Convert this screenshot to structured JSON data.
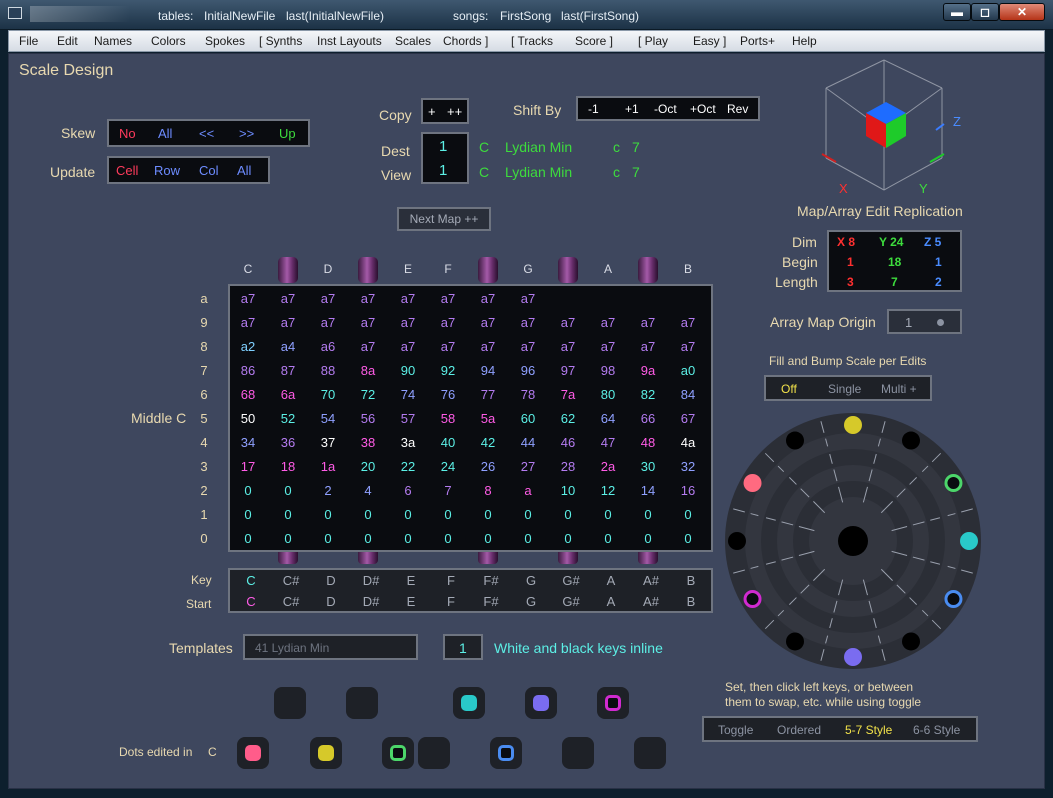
{
  "titlebar": {
    "tables_label": "tables:",
    "tables_value": "InitialNewFile",
    "tables_last": "last(InitialNewFile)",
    "songs_label": "songs:",
    "songs_value": "FirstSong",
    "songs_last": "last(FirstSong)",
    "min": "▬",
    "max": "◻",
    "close": "✕"
  },
  "menu": [
    "File",
    "Edit",
    "Names",
    "Colors",
    "Spokes",
    "[ Synths",
    "Inst Layouts",
    "Scales",
    "Chords ]",
    "[ Tracks",
    "Score ]",
    "[ Play",
    "Easy ]",
    "Ports+",
    "Help"
  ],
  "page_title": "Scale Design",
  "skew": {
    "label": "Skew",
    "options": [
      {
        "text": "No",
        "color": "#ff3b5c"
      },
      {
        "text": "All",
        "color": "#6d8cff"
      },
      {
        "text": "<<",
        "color": "#6d8cff"
      },
      {
        "text": ">>",
        "color": "#6d8cff"
      },
      {
        "text": "Up",
        "color": "#3ddc3d"
      }
    ]
  },
  "update": {
    "label": "Update",
    "options": [
      {
        "text": "Cell",
        "color": "#ff3b5c"
      },
      {
        "text": "Row",
        "color": "#6d8cff"
      },
      {
        "text": "Col",
        "color": "#6d8cff"
      },
      {
        "text": "All",
        "color": "#6d8cff"
      }
    ]
  },
  "copy": {
    "label": "Copy",
    "plus": "+",
    "plusplus": "++"
  },
  "shift": {
    "label": "Shift By",
    "opts": [
      "-1",
      "+1",
      "-Oct",
      "+Oct",
      "Rev"
    ]
  },
  "dest": {
    "label": "Dest",
    "value": "1",
    "key": "C",
    "scale": "Lydian Min",
    "note": "c",
    "num": "7"
  },
  "view": {
    "label": "View",
    "value": "1",
    "key": "C",
    "scale": "Lydian Min",
    "note": "c",
    "num": "7"
  },
  "next_map": "Next Map ++",
  "cube": {
    "x": "X",
    "y": "Y",
    "z": "Z"
  },
  "replication": {
    "title": "Map/Array Edit Replication",
    "rows": [
      {
        "label": "Dim",
        "x": "X  8",
        "y": "Y 24",
        "z": "Z  5"
      },
      {
        "label": "Begin",
        "x": "1",
        "y": "18",
        "z": "1"
      },
      {
        "label": "Length",
        "x": "3",
        "y": "7",
        "z": "2"
      }
    ]
  },
  "origin": {
    "label": "Array Map Origin",
    "value": "1"
  },
  "fill": {
    "label": "Fill and Bump Scale per Edits",
    "opts": [
      {
        "text": "Off",
        "color": "#f2e24a"
      },
      {
        "text": "Single",
        "color": "#8c93a2"
      },
      {
        "text": "Multi +",
        "color": "#8c93a2"
      }
    ]
  },
  "col_headers": [
    "C",
    "",
    "D",
    "",
    "E",
    "F",
    "",
    "G",
    "",
    "A",
    "",
    "B"
  ],
  "row_labels": [
    "a",
    "9",
    "8",
    "7",
    "6",
    "5",
    "4",
    "3",
    "2",
    "1",
    "0"
  ],
  "middle_c": "Middle C",
  "grid": [
    [
      "a7",
      "a7",
      "a7",
      "a7",
      "a7",
      "a7",
      "a7",
      "a7",
      "",
      "",
      "",
      ""
    ],
    [
      "a7",
      "a7",
      "a7",
      "a7",
      "a7",
      "a7",
      "a7",
      "a7",
      "a7",
      "a7",
      "a7",
      "a7"
    ],
    [
      "a2",
      "a4",
      "a6",
      "a7",
      "a7",
      "a7",
      "a7",
      "a7",
      "a7",
      "a7",
      "a7",
      "a7"
    ],
    [
      "86",
      "87",
      "88",
      "8a",
      "90",
      "92",
      "94",
      "96",
      "97",
      "98",
      "9a",
      "a0"
    ],
    [
      "68",
      "6a",
      "70",
      "72",
      "74",
      "76",
      "77",
      "78",
      "7a",
      "80",
      "82",
      "84"
    ],
    [
      "50",
      "52",
      "54",
      "56",
      "57",
      "58",
      "5a",
      "60",
      "62",
      "64",
      "66",
      "67"
    ],
    [
      "34",
      "36",
      "37",
      "38",
      "3a",
      "40",
      "42",
      "44",
      "46",
      "47",
      "48",
      "4a"
    ],
    [
      "17",
      "18",
      "1a",
      "20",
      "22",
      "24",
      "26",
      "27",
      "28",
      "2a",
      "30",
      "32"
    ],
    [
      "0",
      "0",
      "2",
      "4",
      "6",
      "7",
      "8",
      "a",
      "10",
      "12",
      "14",
      "16"
    ],
    [
      "0",
      "0",
      "0",
      "0",
      "0",
      "0",
      "0",
      "0",
      "0",
      "0",
      "0",
      "0"
    ],
    [
      "0",
      "0",
      "0",
      "0",
      "0",
      "0",
      "0",
      "0",
      "0",
      "0",
      "0",
      "0"
    ]
  ],
  "grid_colors": [
    [
      "#b47cf0",
      "#b47cf0",
      "#b47cf0",
      "#b47cf0",
      "#b47cf0",
      "#b47cf0",
      "#b47cf0",
      "#b47cf0",
      "#b47cf0",
      "#b47cf0",
      "#b47cf0",
      "#b47cf0"
    ],
    [
      "#b47cf0",
      "#b47cf0",
      "#b47cf0",
      "#b47cf0",
      "#b47cf0",
      "#b47cf0",
      "#b47cf0",
      "#b47cf0",
      "#b47cf0",
      "#b47cf0",
      "#b47cf0",
      "#b47cf0"
    ],
    [
      "#7fd0ff",
      "#8fa0ff",
      "#b47cf0",
      "#b47cf0",
      "#b47cf0",
      "#b47cf0",
      "#b47cf0",
      "#b47cf0",
      "#b47cf0",
      "#b47cf0",
      "#b47cf0",
      "#b47cf0"
    ],
    [
      "#b47cf0",
      "#b47cf0",
      "#b47cf0",
      "#ff5ce6",
      "#5cf0e6",
      "#5cf0e6",
      "#8fa0ff",
      "#8fa0ff",
      "#b47cf0",
      "#b47cf0",
      "#ff5ce6",
      "#5cf0e6"
    ],
    [
      "#ff5ce6",
      "#ff5ce6",
      "#5cf0e6",
      "#5cf0e6",
      "#8fa0ff",
      "#8fa0ff",
      "#b47cf0",
      "#b47cf0",
      "#ff5ce6",
      "#5cf0e6",
      "#5cf0e6",
      "#8fa0ff"
    ],
    [
      "#ffffff",
      "#5cf0e6",
      "#8fa0ff",
      "#b47cf0",
      "#b47cf0",
      "#ff5ce6",
      "#ff5ce6",
      "#5cf0e6",
      "#5cf0e6",
      "#8fa0ff",
      "#b47cf0",
      "#b47cf0"
    ],
    [
      "#8fa0ff",
      "#b47cf0",
      "#ffffff",
      "#ff5ce6",
      "#ffffff",
      "#5cf0e6",
      "#5cf0e6",
      "#8fa0ff",
      "#b47cf0",
      "#b47cf0",
      "#ff5ce6",
      "#ffffff"
    ],
    [
      "#ff5ce6",
      "#ff5ce6",
      "#ff5ce6",
      "#5cf0e6",
      "#5cf0e6",
      "#5cf0e6",
      "#8fa0ff",
      "#b47cf0",
      "#b47cf0",
      "#ff5ce6",
      "#5cf0e6",
      "#8fa0ff"
    ],
    [
      "#5cf0e6",
      "#5cf0e6",
      "#8fa0ff",
      "#8fa0ff",
      "#b47cf0",
      "#b47cf0",
      "#ff5ce6",
      "#ff5ce6",
      "#5cf0e6",
      "#5cf0e6",
      "#8fa0ff",
      "#b47cf0"
    ],
    [
      "#5cf0e6",
      "#5cf0e6",
      "#5cf0e6",
      "#5cf0e6",
      "#5cf0e6",
      "#5cf0e6",
      "#5cf0e6",
      "#5cf0e6",
      "#5cf0e6",
      "#5cf0e6",
      "#5cf0e6",
      "#5cf0e6"
    ],
    [
      "#5cf0e6",
      "#5cf0e6",
      "#5cf0e6",
      "#5cf0e6",
      "#5cf0e6",
      "#5cf0e6",
      "#5cf0e6",
      "#5cf0e6",
      "#5cf0e6",
      "#5cf0e6",
      "#5cf0e6",
      "#5cf0e6"
    ]
  ],
  "keys": {
    "key_label": "Key",
    "start_label": "Start",
    "key_row": [
      "C",
      "C#",
      "D",
      "D#",
      "E",
      "F",
      "F#",
      "G",
      "G#",
      "A",
      "A#",
      "B"
    ],
    "start_row": [
      "C",
      "C#",
      "D",
      "D#",
      "E",
      "F",
      "F#",
      "G",
      "G#",
      "A",
      "A#",
      "B"
    ]
  },
  "templates": {
    "label": "Templates",
    "value": "41   Lydian Min",
    "inline_value": "1",
    "inline_label": "White and black keys inline"
  },
  "dots_label": "Dots edited in",
  "dots_key": "C",
  "pads_top": [
    {
      "color": "",
      "ring": false
    },
    {
      "color": "",
      "ring": false
    },
    {
      "color": "#29c9c9",
      "ring": false
    },
    {
      "color": "#7a6cf0",
      "ring": false
    },
    {
      "color": "#d02ad0",
      "ring": true
    }
  ],
  "pads_bottom": [
    {
      "color": "#ff5c8a",
      "ring": false
    },
    {
      "color": "#d6c92a",
      "ring": false
    },
    {
      "color": "#4cd66a",
      "ring": true
    },
    {
      "color": "",
      "ring": false
    },
    {
      "color": "#4a8cf0",
      "ring": true
    },
    {
      "color": "",
      "ring": false
    },
    {
      "color": "",
      "ring": false
    }
  ],
  "wheel_dots": [
    {
      "a": 0,
      "color": "#d6c92a",
      "fill": true
    },
    {
      "a": 30,
      "color": "#000000",
      "fill": true
    },
    {
      "a": 60,
      "color": "#4cd66a",
      "fill": false
    },
    {
      "a": 90,
      "color": "#29c9c9",
      "fill": true
    },
    {
      "a": 120,
      "color": "#4a8cf0",
      "fill": false
    },
    {
      "a": 150,
      "color": "#000000",
      "fill": true
    },
    {
      "a": 180,
      "color": "#7a6cf0",
      "fill": true
    },
    {
      "a": 210,
      "color": "#000000",
      "fill": true
    },
    {
      "a": 240,
      "color": "#d02ad0",
      "fill": false
    },
    {
      "a": 270,
      "color": "#000000",
      "fill": true
    },
    {
      "a": 300,
      "color": "#ff6a80",
      "fill": true
    },
    {
      "a": 330,
      "color": "#000000",
      "fill": true
    }
  ],
  "help_text_1": "Set, then click left keys, or between",
  "help_text_2": "them to swap, etc. while using toggle",
  "style": [
    {
      "text": "Toggle",
      "color": "#8c93a2"
    },
    {
      "text": "Ordered",
      "color": "#8c93a2"
    },
    {
      "text": "5-7 Style",
      "color": "#f2e24a"
    },
    {
      "text": "6-6 Style",
      "color": "#8c93a2"
    }
  ]
}
